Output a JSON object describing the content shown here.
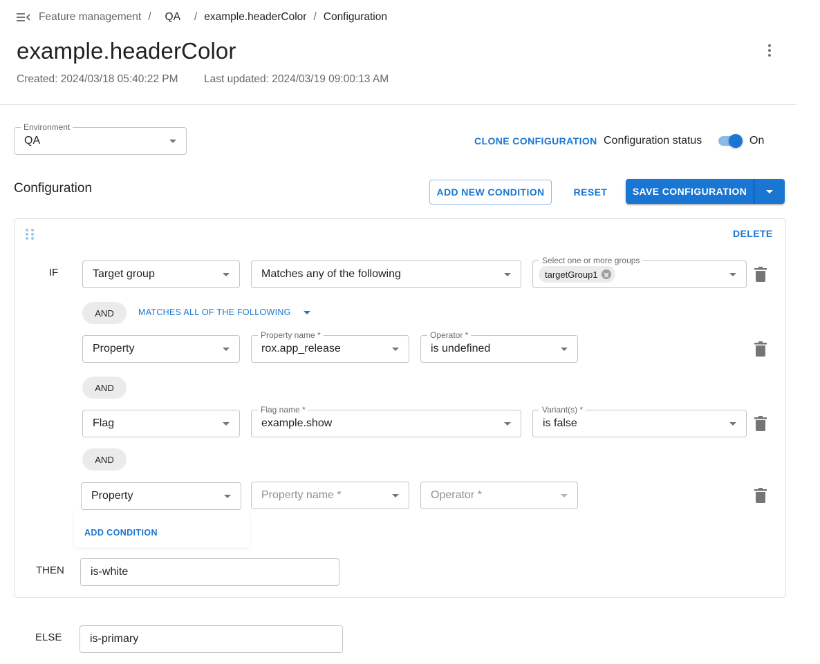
{
  "breadcrumb": {
    "menu_icon": "menu-collapse-icon",
    "items": [
      "Feature management",
      "QA",
      "example.headerColor",
      "Configuration"
    ]
  },
  "header": {
    "title": "example.headerColor",
    "created": "Created: 2024/03/18 05:40:22 PM",
    "last_updated": "Last updated: 2024/03/19 09:00:13 AM",
    "more_icon": "more-vert-icon"
  },
  "environment": {
    "label": "Environment",
    "value": "QA"
  },
  "actions": {
    "clone": "CLONE CONFIGURATION",
    "status_label": "Configuration status",
    "status_on": true,
    "status_text": "On"
  },
  "configuration": {
    "title": "Configuration",
    "add_new_condition": "ADD NEW CONDITION",
    "reset": "RESET",
    "save": "SAVE CONFIGURATION"
  },
  "rule": {
    "delete": "DELETE",
    "if_label": "IF",
    "target_group": {
      "type": "Target group",
      "match": "Matches any of the following",
      "groups_label": "Select one or more groups",
      "groups": [
        "targetGroup1"
      ]
    },
    "and_label": "AND",
    "matches_mode": "MATCHES ALL OF THE FOLLOWING",
    "conditions": [
      {
        "type": "Property",
        "name_label": "Property name *",
        "name_value": "rox.app_release",
        "op_label": "Operator *",
        "op_value": "is undefined"
      },
      {
        "type": "Flag",
        "name_label": "Flag name *",
        "name_value": "example.show",
        "op_label": "Variant(s) *",
        "op_value": "is false"
      },
      {
        "type": "Property",
        "name_placeholder": "Property name *",
        "op_placeholder": "Operator *"
      }
    ],
    "add_condition": "ADD CONDITION",
    "then_label": "THEN",
    "then_value": "is-white"
  },
  "else": {
    "label": "ELSE",
    "value": "is-primary"
  },
  "colors": {
    "primary": "#1976d2",
    "chip": "#ebebeb",
    "icon": "#757575"
  }
}
